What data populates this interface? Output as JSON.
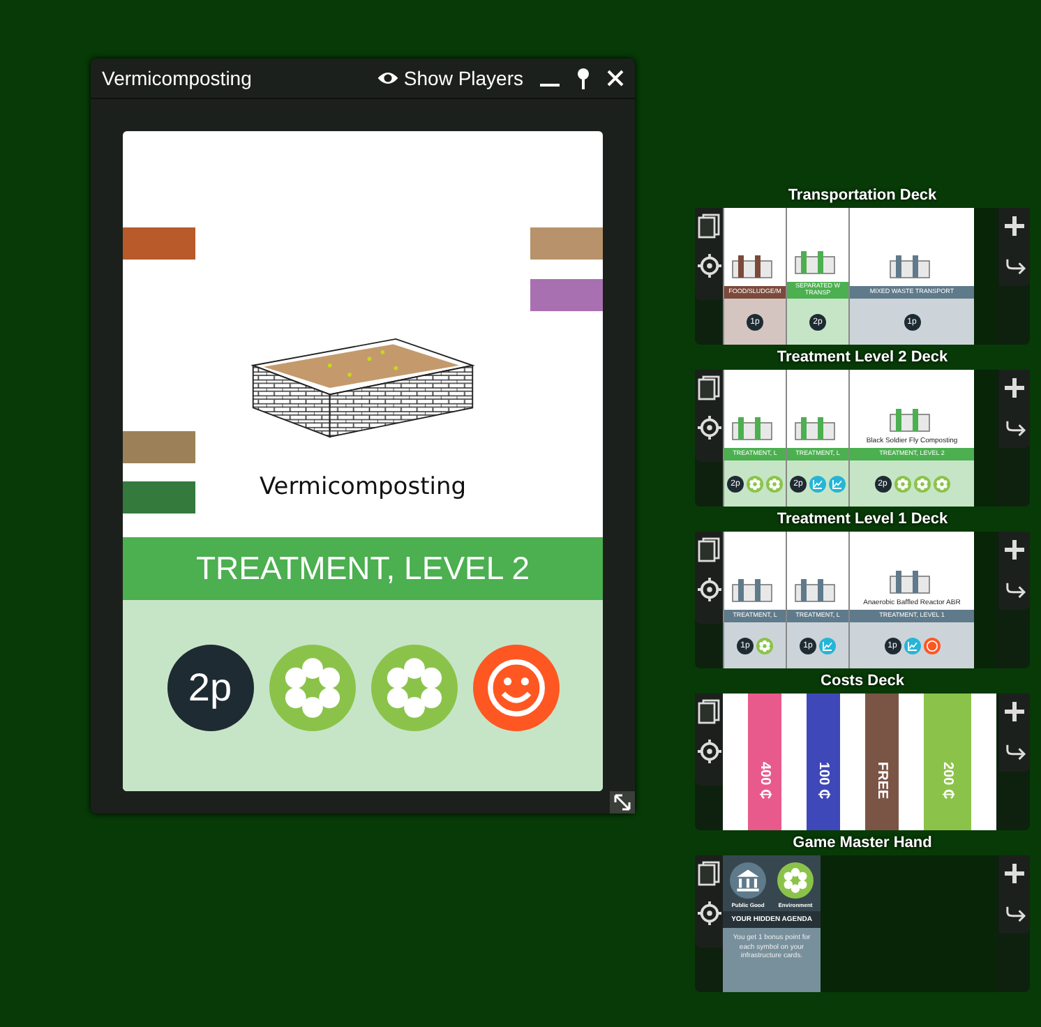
{
  "window": {
    "title": "Vermicomposting",
    "show_players": "Show Players"
  },
  "card": {
    "name": "Vermicomposting",
    "category": "TREATMENT, LEVEL 2",
    "color": "#4caf50",
    "left_bars": [
      {
        "color": "#b85a2a"
      },
      {
        "color": "#9c8158"
      },
      {
        "color": "#347a3c"
      }
    ],
    "right_bars": [
      {
        "color": "#b8926a"
      },
      {
        "color": "#a870b0"
      }
    ],
    "badges": [
      {
        "kind": "players",
        "text": "2p"
      },
      {
        "kind": "environment"
      },
      {
        "kind": "environment"
      },
      {
        "kind": "social"
      }
    ]
  },
  "decks": [
    {
      "title": "Transportation Deck",
      "kind": "cards",
      "cards": [
        {
          "label": "FOOD/SLUDGE/M",
          "color": "#7b4a3a",
          "badges": [
            {
              "kind": "players",
              "text": "1p"
            }
          ]
        },
        {
          "label": "SEPARATED W TRANSP",
          "color": "#4caf50",
          "badges": [
            {
              "kind": "players",
              "text": "2p"
            }
          ]
        },
        {
          "label": "MIXED WASTE TRANSPORT",
          "color": "#5f7a8a",
          "badges": [
            {
              "kind": "players",
              "text": "1p"
            }
          ]
        }
      ]
    },
    {
      "title": "Treatment Level 2 Deck",
      "kind": "cards",
      "cards": [
        {
          "label": "TREATMENT, L",
          "color": "#4caf50",
          "badges": [
            {
              "kind": "players",
              "text": "2p"
            },
            {
              "kind": "environment"
            },
            {
              "kind": "environment"
            }
          ]
        },
        {
          "label": "TREATMENT, L",
          "color": "#4caf50",
          "badges": [
            {
              "kind": "players",
              "text": "2p"
            },
            {
              "kind": "economy"
            },
            {
              "kind": "economy"
            }
          ]
        },
        {
          "label": "TREATMENT, LEVEL 2",
          "caption": "Black Soldier Fly Composting",
          "color": "#4caf50",
          "badges": [
            {
              "kind": "players",
              "text": "2p"
            },
            {
              "kind": "environment"
            },
            {
              "kind": "environment"
            },
            {
              "kind": "environment"
            }
          ]
        }
      ]
    },
    {
      "title": "Treatment Level 1 Deck",
      "kind": "cards",
      "cards": [
        {
          "label": "TREATMENT, L",
          "color": "#5f7a8a",
          "badges": [
            {
              "kind": "players",
              "text": "1p"
            },
            {
              "kind": "environment"
            }
          ]
        },
        {
          "label": "TREATMENT, L",
          "color": "#5f7a8a",
          "badges": [
            {
              "kind": "players",
              "text": "1p"
            },
            {
              "kind": "economy"
            }
          ]
        },
        {
          "label": "TREATMENT, LEVEL 1",
          "caption": "Anaerobic Baffled Reactor ABR",
          "color": "#5f7a8a",
          "badges": [
            {
              "kind": "players",
              "text": "1p"
            },
            {
              "kind": "economy"
            },
            {
              "kind": "social"
            }
          ]
        }
      ]
    },
    {
      "title": "Costs Deck",
      "kind": "costs",
      "cards": [
        {
          "text": "400 ₵",
          "color": "#e85a8c"
        },
        {
          "text": "100 ₵",
          "color": "#3f48b8"
        },
        {
          "text": "FREE",
          "color": "#7a5444"
        },
        {
          "text": "200 ₵",
          "color": "#8bc34a"
        }
      ]
    },
    {
      "title": "Game Master Hand",
      "kind": "hand",
      "hand": {
        "symbols": [
          {
            "kind": "public",
            "label": "Public Good"
          },
          {
            "kind": "environment",
            "label": "Environment"
          }
        ],
        "heading": "YOUR HIDDEN AGENDA",
        "text": "You get 1 bonus point for each symbol on your infrastructure cards."
      }
    }
  ]
}
